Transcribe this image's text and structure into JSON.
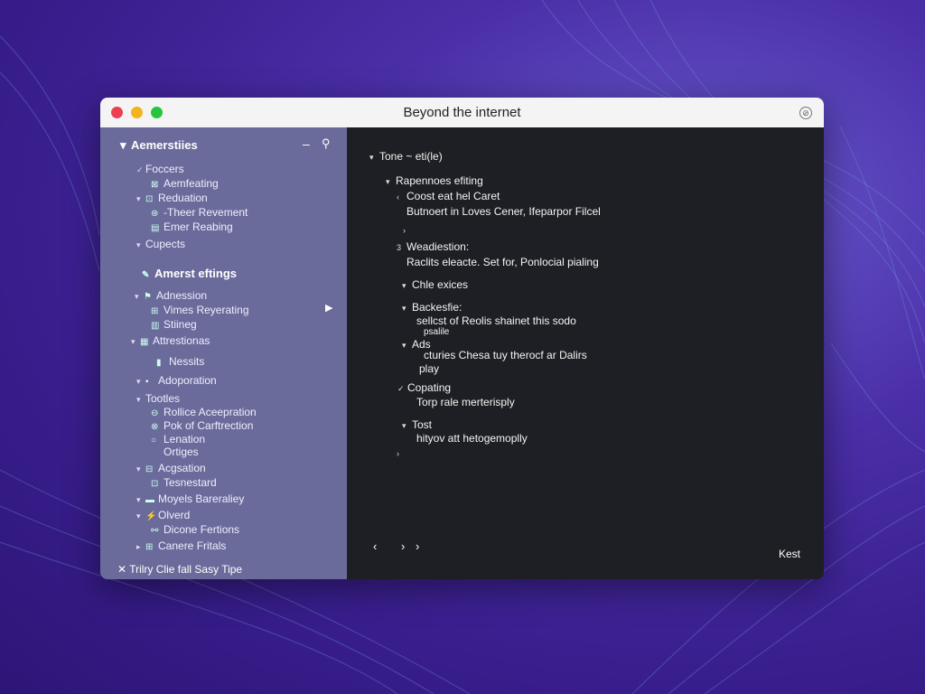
{
  "window": {
    "title": "Beyond the internet",
    "share_glyph": "⊘"
  },
  "sidebar": {
    "header": "Aemerstiies",
    "minus_glyph": "–",
    "pin_glyph": "⚲",
    "items": [
      {
        "label": "Foccers",
        "chev": "✓"
      },
      {
        "label": "Aemfeating",
        "icon": "⊠"
      },
      {
        "label": "Reduation",
        "chev": "▾",
        "icon": "⊡"
      },
      {
        "label": "-Theer Revement",
        "icon": "⊛"
      },
      {
        "label": "Emer Reabing",
        "icon": "▤"
      },
      {
        "label": "Cupects",
        "chev": "▾"
      },
      {
        "label": "Amerst eftings",
        "icon": "✎"
      },
      {
        "label": "Adnession",
        "chev": "▾",
        "icon": "⚑"
      },
      {
        "label": "Vimes Reyerating",
        "icon": "⊞"
      },
      {
        "label": "Stiineg",
        "icon": "▥"
      },
      {
        "label": "Attrestionas",
        "chev": "▾",
        "icon": "▦"
      },
      {
        "label": "Nessits",
        "icon": "▮"
      },
      {
        "label": "Adoporation",
        "chev": "▾",
        "icon": "▪"
      },
      {
        "label": "Tootles",
        "chev": "▾"
      },
      {
        "label": "Rollice Aceepration",
        "icon": "⊖"
      },
      {
        "label": "Pok of Carftrection",
        "icon": "⊗"
      },
      {
        "label": "Lenation",
        "icon": "○"
      },
      {
        "label": "Ortiges"
      },
      {
        "label": "Acgsation",
        "chev": "▾",
        "icon": "⊟"
      },
      {
        "label": "Tesnestard",
        "icon": "⊡"
      },
      {
        "label": "Moyels Bareraliey",
        "chev": "▾",
        "icon": "▬"
      },
      {
        "label": "Olverd",
        "chev": "▾",
        "icon": "⚡"
      },
      {
        "label": "Dicone Fertions",
        "icon": "⚯"
      },
      {
        "label": "Canere Fritals",
        "chev": "▸",
        "icon": "⊞"
      }
    ],
    "play_glyph": "▶",
    "footer": "Trilry Clie fall Sasy Tipe",
    "footer_icon": "✕"
  },
  "content": {
    "lines": [
      {
        "chev": "▾",
        "text": "Tone ~ eti(le)"
      },
      {
        "chev": "▾",
        "text": "Rapennoes efiting"
      },
      {
        "chev": "‹",
        "text": "Coost eat hel Caret"
      },
      {
        "text": "Butnoert in Loves Cener, Ifeparpor Filcel"
      },
      {
        "chev": "›",
        "text": ""
      },
      {
        "chev": "3",
        "text": "Weadiestion:"
      },
      {
        "text": "Raclits eleacte. Set for, Ponlocial pialing"
      },
      {
        "chev": "▾",
        "text": "Chle exices"
      },
      {
        "chev": "▾",
        "text": "Backesfie:"
      },
      {
        "text": "sellcst of Reolis shainet this sodo"
      },
      {
        "text": "psalile"
      },
      {
        "chev": "▾",
        "text": "Ads"
      },
      {
        "text": "cturies Chesa tuy therocf ar Dalirs"
      },
      {
        "text": "play"
      },
      {
        "chev": "✓",
        "text": "Copating"
      },
      {
        "text": "Torp rale merterisply"
      },
      {
        "chev": "▾",
        "text": "Tost"
      },
      {
        "text": "hityov att hetogemoplly"
      },
      {
        "chev": "›",
        "text": ""
      }
    ],
    "nav_back": "‹",
    "nav_forward": "›",
    "nav_forward2": "›",
    "corner_button": "Kest"
  }
}
